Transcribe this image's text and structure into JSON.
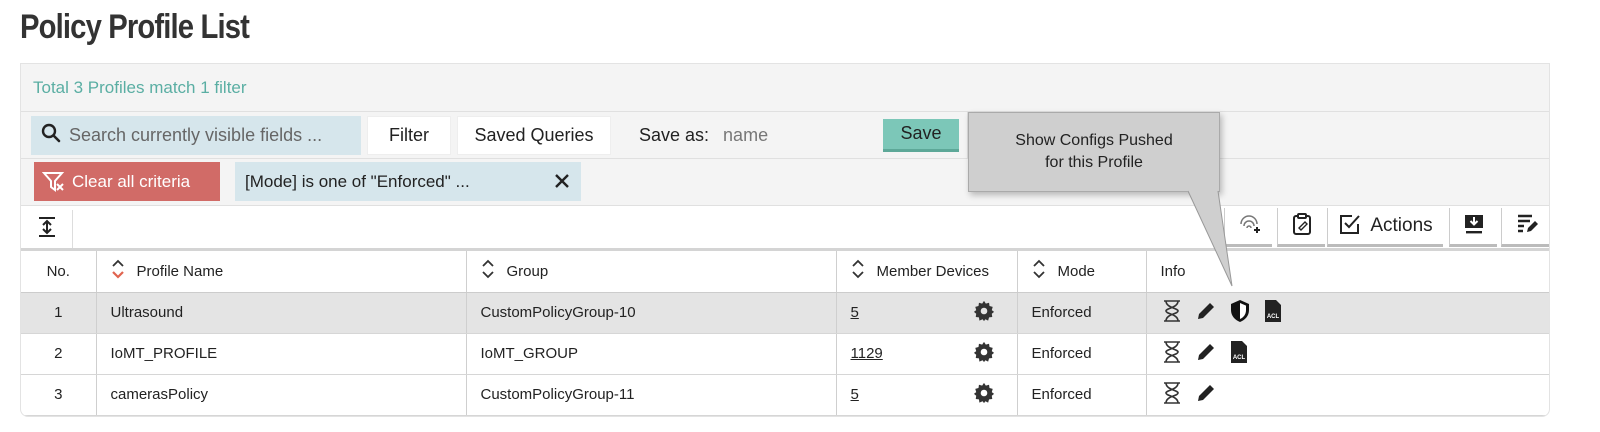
{
  "page": {
    "title": "Policy Profile List"
  },
  "summary": {
    "text": "Total 3 Profiles match 1 filter"
  },
  "search": {
    "placeholder": "Search currently visible fields ...",
    "filter_label": "Filter",
    "saved_queries_label": "Saved Queries",
    "save_as_label": "Save as:",
    "save_as_placeholder": "name",
    "save_label": "Save"
  },
  "filters": {
    "clear_label": "Clear all criteria",
    "criteria_text": "[Mode] is one of \"Enforced\" ...",
    "remove_icon": "close-icon"
  },
  "toolbar": {
    "actions_label": "Actions"
  },
  "tooltip": {
    "line1": "Show Configs Pushed",
    "line2": "for this Profile"
  },
  "table": {
    "columns": [
      "No.",
      "Profile Name",
      "Group",
      "Member Devices",
      "Mode",
      "Info"
    ],
    "rows": [
      {
        "no": "1",
        "name": "Ultrasound",
        "group": "CustomPolicyGroup-10",
        "members": "5",
        "mode": "Enforced",
        "icons": [
          "hourglass",
          "pencil",
          "shield",
          "acl"
        ]
      },
      {
        "no": "2",
        "name": "IoMT_PROFILE",
        "group": "IoMT_GROUP",
        "members": "1129",
        "mode": "Enforced",
        "icons": [
          "hourglass",
          "pencil",
          "acl"
        ]
      },
      {
        "no": "3",
        "name": "camerasPolicy",
        "group": "CustomPolicyGroup-11",
        "members": "5",
        "mode": "Enforced",
        "icons": [
          "hourglass",
          "pencil"
        ]
      }
    ]
  },
  "colors": {
    "accent_teal": "#7cc7b8",
    "summary_teal": "#5aaea3",
    "clear_red": "#d16b67",
    "chip_blue": "#d6e6ec",
    "sort_active": "#e0644f"
  }
}
